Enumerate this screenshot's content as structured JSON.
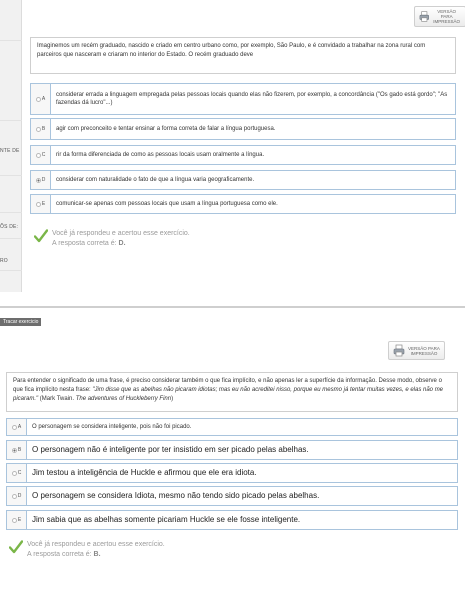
{
  "sidebar_fragments": [
    "NTE DE",
    "ÕS DE:",
    "RO"
  ],
  "print_button": {
    "label_line1": "VERSÃO PARA",
    "label_line2": "IMPRESSÃO"
  },
  "exercise1": {
    "question": "Imaginemos um recém graduado, nascido e criado em centro urbano como, por exemplo, São Paulo, e é convidado a trabalhar na zona rural com parceiros que nasceram e criaram no interior do Estado. O recém graduado deve",
    "options": [
      {
        "letter": "A",
        "text": "considerar errada a linguagem empregada pelas pessoas locais quando elas não fizerem, por exemplo, a concordância (\"Os gado está gordo\"; \"As fazendas dá lucro\"...)",
        "selected": false
      },
      {
        "letter": "B",
        "text": "agir com preconceito e tentar ensinar a forma correta de falar a língua portuguesa.",
        "selected": false
      },
      {
        "letter": "C",
        "text": "rir da forma diferenciada de como as pessoas locais usam oralmente a língua.",
        "selected": false
      },
      {
        "letter": "D",
        "text": "considerar com naturalidade o fato de que a língua varia geograficamente.",
        "selected": true
      },
      {
        "letter": "E",
        "text": "comunicar-se apenas com pessoas locais que usam a língua portuguesa como ele.",
        "selected": false
      }
    ],
    "feedback_line1": "Você já respondeu e acertou esse exercício.",
    "feedback_line2_prefix": "A resposta correta é:",
    "correct": "D."
  },
  "tab_label": "Tracar exercicio",
  "exercise2": {
    "question_plain": "Para entender o significado de uma frase, é preciso considerar também o que fica implícito, e não apenas ler a superfície da informação. Desse modo, observe o que fica implícito nesta frase: ",
    "question_quote": "\"Jim disse que as abelhas não picaram idiotas; mas eu não acreditei nisso, porque eu mesmo já tentar muitas vezes, e elas não me picaram.\"",
    "question_source": " (Mark Twain. ",
    "question_book": "The adventures of Huckleberry Finn",
    "question_end": ")",
    "options": [
      {
        "letter": "A",
        "text": "O personagem se considera inteligente, pois não foi picado.",
        "selected": false,
        "big": false
      },
      {
        "letter": "B",
        "text": "O personagem não é inteligente por ter insistido em ser picado pelas abelhas.",
        "selected": true,
        "big": true
      },
      {
        "letter": "C",
        "text": "Jim testou a inteligência de Huckle e afirmou que ele era idiota.",
        "selected": false,
        "big": true
      },
      {
        "letter": "D",
        "text": "O personagem se considera Idiota, mesmo não tendo sido picado pelas abelhas.",
        "selected": false,
        "big": true
      },
      {
        "letter": "E",
        "text": "Jim sabia que as abelhas somente picariam Huckle se ele fosse inteligente.",
        "selected": false,
        "big": true
      }
    ],
    "feedback_line1": "Você já respondeu e acertou esse exercício.",
    "feedback_line2_prefix": "A resposta correta é:",
    "correct": "B."
  },
  "colors": {
    "option_border": "#a9c4dd",
    "check_green": "#7ab648"
  }
}
